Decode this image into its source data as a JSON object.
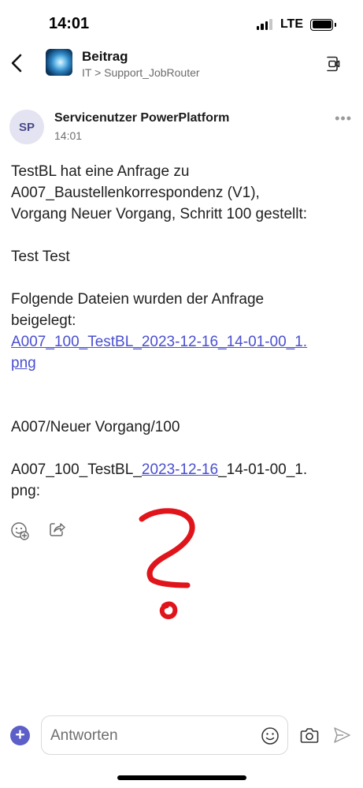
{
  "status_bar": {
    "time": "14:01",
    "network": "LTE",
    "signal_bars": 3,
    "signal_bars_total": 4,
    "battery_level": 1.0
  },
  "header": {
    "title": "Beitrag",
    "subtitle": "IT > Support_JobRouter"
  },
  "message": {
    "sender_initials": "SP",
    "sender_name": "Servicenutzer PowerPlatform",
    "time": "14:01",
    "lines": {
      "l1": "TestBL hat eine Anfrage zu",
      "l2": "A007_Baustellenkorrespondenz (V1),",
      "l3": "Vorgang Neuer Vorgang, Schritt 100 gestellt:",
      "l4": "Test Test",
      "l5": "Folgende Dateien wurden der Anfrage",
      "l6": "beigelegt:",
      "link_line1": "A007_100_TestBL_2023-12-16_14-01-00_1.",
      "link_line2": "png",
      "l7": "A007/Neuer Vorgang/100",
      "l8_prefix": "A007_100_TestBL_",
      "l8_date_link": "2023-12-16",
      "l8_suffix": "_14-01-00_1.",
      "l9": "png:"
    }
  },
  "compose": {
    "placeholder": "Antworten"
  },
  "colors": {
    "accent": "#5b5fc7",
    "link": "#4a4fd0",
    "annotation": "#e0141b",
    "avatar_bg": "#e3e3f1"
  },
  "icons": [
    "back-arrow",
    "meet-now",
    "more-dots",
    "add-reaction",
    "share",
    "add",
    "emoji",
    "camera",
    "send"
  ]
}
